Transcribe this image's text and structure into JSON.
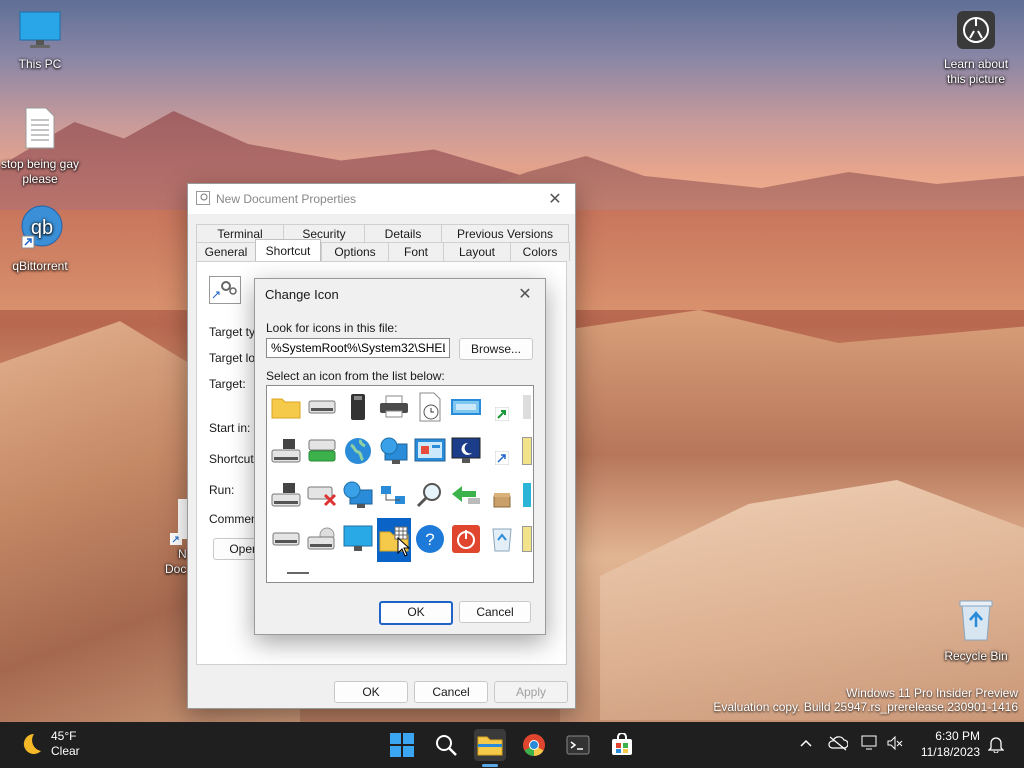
{
  "desktop": {
    "icons": [
      {
        "label": "This PC",
        "icon": "monitor-icon"
      },
      {
        "label": "stop being gay please",
        "icon": "text-document-icon"
      },
      {
        "label": "qBittorrent",
        "icon": "qbittorrent-icon"
      },
      {
        "label": "N",
        "icon": "shortcut-icon"
      },
      {
        "label": "Doc",
        "icon": "shortcut-icon"
      }
    ],
    "learn_about": {
      "line1": "Learn about",
      "line2": "this picture",
      "icon": "camera-info-icon"
    },
    "recycle_bin": {
      "label": "Recycle Bin",
      "icon": "recycle-bin-icon"
    },
    "watermark": {
      "line1": "Windows 11 Pro Insider Preview",
      "line2": "Evaluation copy. Build 25947.rs_prerelease.230901-1416"
    }
  },
  "properties": {
    "title": "New  Document Properties",
    "tabs_top": [
      "Terminal",
      "Security",
      "Details",
      "Previous Versions"
    ],
    "tabs_bottom": [
      "General",
      "Shortcut",
      "Options",
      "Font",
      "Layout",
      "Colors"
    ],
    "active_tab": "Shortcut",
    "fields": {
      "target_type": "Target typ",
      "target_location": "Target loc",
      "target": "Target:",
      "start_in": "Start in:",
      "shortcut_key": "Shortcut k",
      "run": "Run:",
      "comment": "Comment:"
    },
    "open_button": "Open",
    "ok": "OK",
    "cancel": "Cancel",
    "apply": "Apply"
  },
  "change_icon": {
    "title": "Change Icon",
    "look_label": "Look for icons in this file:",
    "file_value": "%SystemRoot%\\System32\\SHELL32.dll",
    "browse": "Browse...",
    "list_label": "Select an icon from the list below:",
    "ok": "OK",
    "cancel": "Cancel",
    "icons": [
      [
        "folder-icon",
        "drive-icon",
        "chip-icon",
        "printer-icon",
        "clock-document-icon",
        "screen-icon",
        "shortcut-arrow-icon",
        "partial-icon"
      ],
      [
        "network-drive-icon",
        "green-drive-icon",
        "globe-icon",
        "globe-monitor-icon",
        "control-panel-icon",
        "sleep-monitor-icon",
        "shortcut-arrow-icon",
        "partial-icon"
      ],
      [
        "floppy-drive-icon",
        "disconnected-drive-icon",
        "network-globe-icon",
        "network-icon",
        "magnifier-icon",
        "usb-icon",
        "box-icon",
        "partial-icon"
      ],
      [
        "drive-icon",
        "cd-drive-icon",
        "monitor-icon",
        "folder-window-icon",
        "help-icon",
        "power-icon",
        "recycle-icon",
        "partial-icon"
      ]
    ]
  },
  "taskbar": {
    "weather": {
      "temp": "45°F",
      "condition": "Clear",
      "icon": "moon-icon"
    },
    "time": "6:30 PM",
    "date": "11/18/2023",
    "apps": [
      "windows-start-icon",
      "search-icon",
      "file-explorer-icon",
      "chrome-icon",
      "terminal-icon",
      "store-icon"
    ]
  }
}
